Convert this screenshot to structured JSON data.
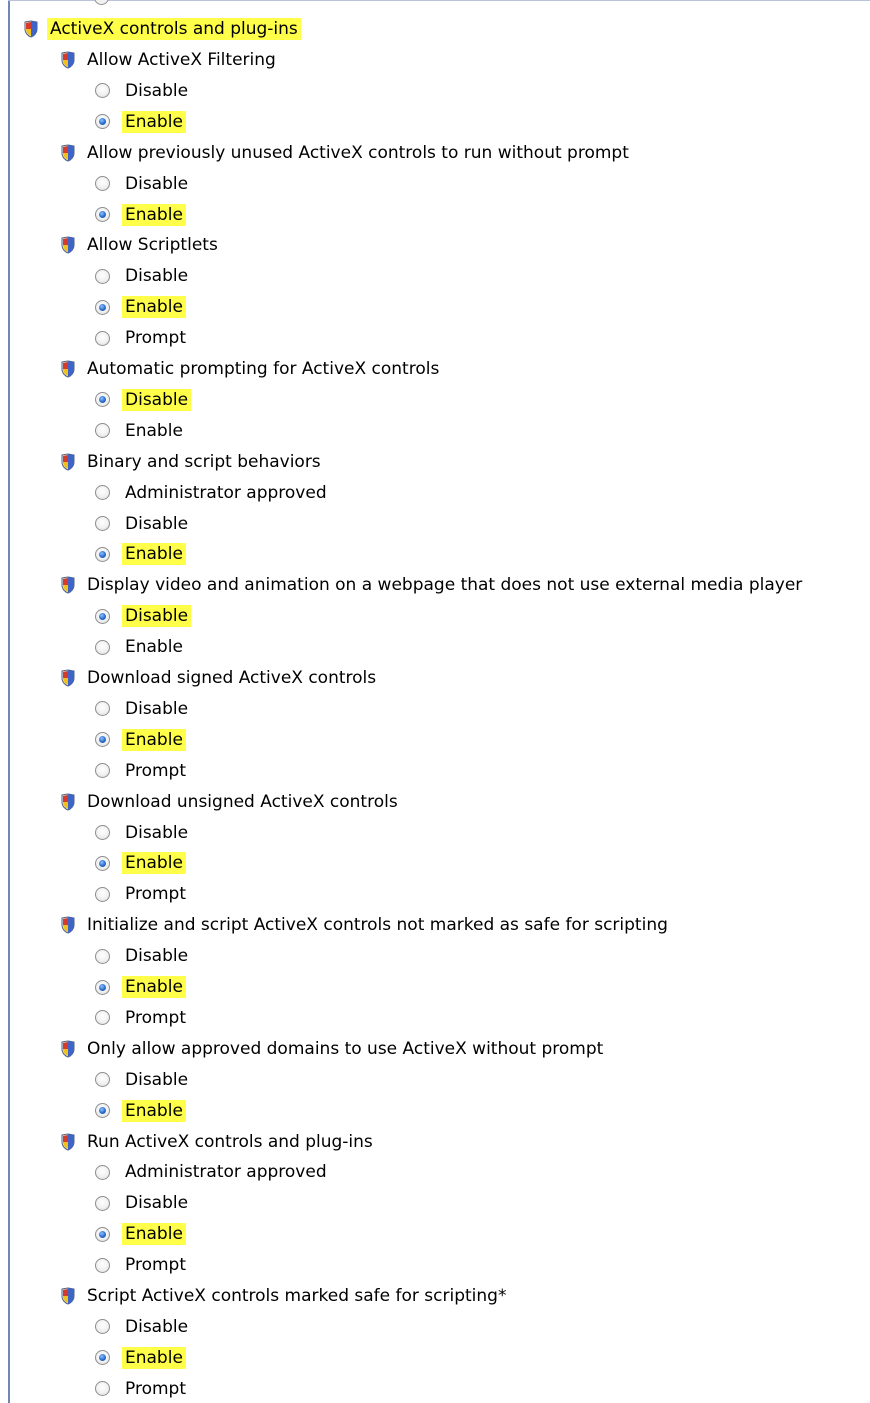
{
  "root": {
    "label": "ActiveX controls and plug-ins",
    "highlighted": true
  },
  "settings": [
    {
      "label": "Allow ActiveX Filtering",
      "options": [
        "Disable",
        "Enable"
      ],
      "selected": 1
    },
    {
      "label": "Allow previously unused ActiveX controls to run without prompt",
      "options": [
        "Disable",
        "Enable"
      ],
      "selected": 1
    },
    {
      "label": "Allow Scriptlets",
      "options": [
        "Disable",
        "Enable",
        "Prompt"
      ],
      "selected": 1
    },
    {
      "label": "Automatic prompting for ActiveX controls",
      "options": [
        "Disable",
        "Enable"
      ],
      "selected": 0
    },
    {
      "label": "Binary and script behaviors",
      "options": [
        "Administrator approved",
        "Disable",
        "Enable"
      ],
      "selected": 2
    },
    {
      "label": "Display video and animation on a webpage that does not use external media player",
      "options": [
        "Disable",
        "Enable"
      ],
      "selected": 0
    },
    {
      "label": "Download signed ActiveX controls",
      "options": [
        "Disable",
        "Enable",
        "Prompt"
      ],
      "selected": 1
    },
    {
      "label": "Download unsigned ActiveX controls",
      "options": [
        "Disable",
        "Enable",
        "Prompt"
      ],
      "selected": 1
    },
    {
      "label": "Initialize and script ActiveX controls not marked as safe for scripting",
      "options": [
        "Disable",
        "Enable",
        "Prompt"
      ],
      "selected": 1
    },
    {
      "label": "Only allow approved domains to use ActiveX without prompt",
      "options": [
        "Disable",
        "Enable"
      ],
      "selected": 1
    },
    {
      "label": "Run ActiveX controls and plug-ins",
      "options": [
        "Administrator approved",
        "Disable",
        "Enable",
        "Prompt"
      ],
      "selected": 2
    },
    {
      "label": "Script ActiveX controls marked safe for scripting*",
      "options": [
        "Disable",
        "Enable",
        "Prompt"
      ],
      "selected": 1
    }
  ],
  "colors": {
    "highlight": "#ffff4a",
    "radio_dot": "#2a6ccd",
    "frame": "#6f86b7"
  },
  "icons": {
    "setting": "security-shield-icon"
  }
}
